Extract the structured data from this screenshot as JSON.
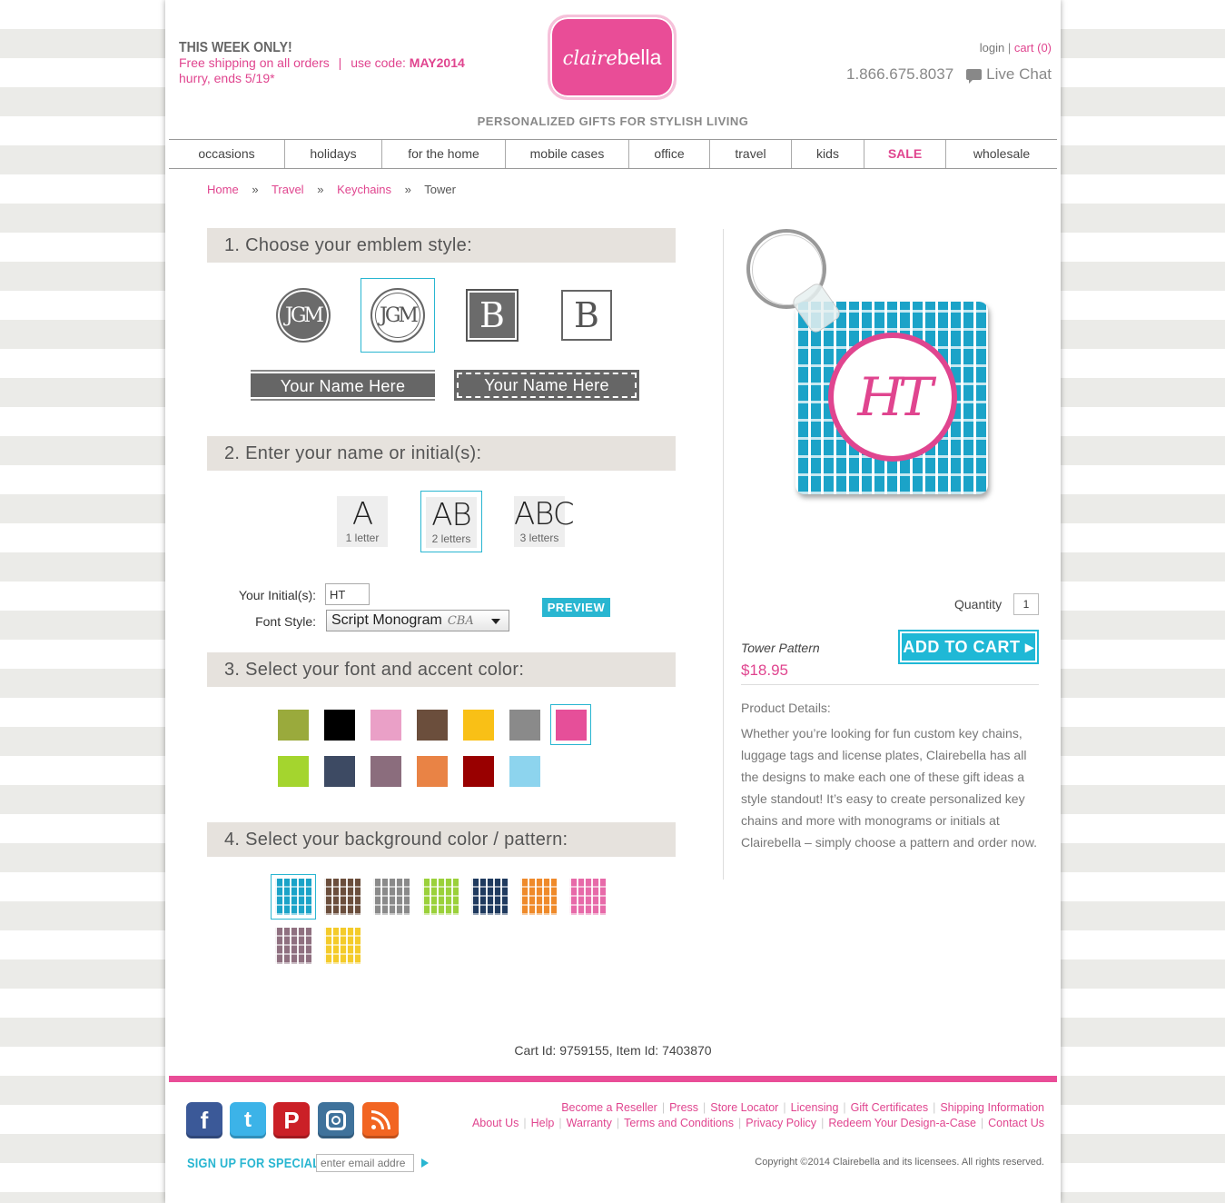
{
  "header": {
    "promo_headline": "THIS WEEK ONLY!",
    "promo_line1": "Free shipping on all orders",
    "promo_sep": "|",
    "promo_use_code": "use code:",
    "promo_code": "MAY2014",
    "promo_line2": "hurry, ends 5/19*",
    "logo_part1": "claire",
    "logo_part2": "bella",
    "tagline": "PERSONALIZED GIFTS FOR STYLISH LIVING",
    "login": "login",
    "account_sep": "|",
    "cart": "cart (0)",
    "phone": "1.866.675.8037",
    "live_chat": "Live Chat"
  },
  "nav": [
    "occasions",
    "holidays",
    "for the home",
    "mobile cases",
    "office",
    "travel",
    "kids",
    "SALE",
    "wholesale"
  ],
  "breadcrumb": {
    "home": "Home",
    "travel": "Travel",
    "keychains": "Keychains",
    "current": "Tower",
    "sep": "»"
  },
  "steps": {
    "step1": "1. Choose your emblem style:",
    "step2": "2. Enter your name or initial(s):",
    "step3": "3. Select your font and accent color:",
    "step4": "4. Select your background color / pattern:"
  },
  "emblems": {
    "monogram1": "JGM",
    "monogram2": "JGM",
    "block1": "B",
    "block2": "B",
    "banner1": "Your Name Here",
    "banner2": "Your Name Here"
  },
  "letter_options": [
    {
      "big": "A",
      "small": "1 letter"
    },
    {
      "big": "AB",
      "small": "2 letters"
    },
    {
      "big": "ABC",
      "small": "3 letters"
    }
  ],
  "form": {
    "initials_label": "Your Initial(s):",
    "initials_value": "HT",
    "font_label": "Font Style:",
    "font_value": "Script Monogram",
    "font_sample": "CBA",
    "preview": "PREVIEW"
  },
  "accent_colors": [
    "#9aaa3c",
    "#000000",
    "#eaa0c7",
    "#6b4e3c",
    "#f9c016",
    "#8a8a8a",
    "#e64f99",
    "#a4d52e",
    "#3d4a63",
    "#8b6d7d",
    "#e98345",
    "#990000",
    "#8dd4ee"
  ],
  "selected_accent": "#e64f99",
  "patterns": [
    "#1ba3c8",
    "#6b4e3c",
    "#8a8a8a",
    "#9bd13a",
    "#1f3a5f",
    "#ef8a2a",
    "#e76aa9",
    "#8f7080",
    "#f4cb2a"
  ],
  "selected_pattern": "#1ba3c8",
  "product": {
    "preview_initials": "HT",
    "quantity_label": "Quantity",
    "quantity": "1",
    "add_to_cart": "ADD TO CART ▸",
    "name": "Tower Pattern",
    "price": "$18.95",
    "details_title": "Product Details:",
    "details_body": "Whether you’re looking for fun custom key chains, luggage tags and license plates, Clairebella has all the designs to make each one of these gift ideas a style standout! It’s easy to create personalized key chains and more with monograms or initials at Clairebella – simply choose a pattern and order now."
  },
  "cart_id": "Cart Id: 9759155, Item Id: 7403870",
  "footer": {
    "social": [
      "facebook-icon",
      "twitter-icon",
      "pinterest-icon",
      "instagram-icon",
      "rss-icon"
    ],
    "signup_label": "SIGN UP FOR SPECIALS",
    "signup_placeholder": "enter email addre",
    "links_row1": [
      "Become a Reseller",
      "Press",
      "Store Locator",
      "Licensing",
      "Gift Certificates",
      "Shipping Information"
    ],
    "links_row2": [
      "About Us",
      "Help",
      "Warranty",
      "Terms and Conditions",
      "Privacy Policy",
      "Redeem Your Design-a-Case",
      "Contact Us"
    ],
    "copyright": "Copyright ©2014 Clairebella and its licensees. All rights reserved."
  }
}
